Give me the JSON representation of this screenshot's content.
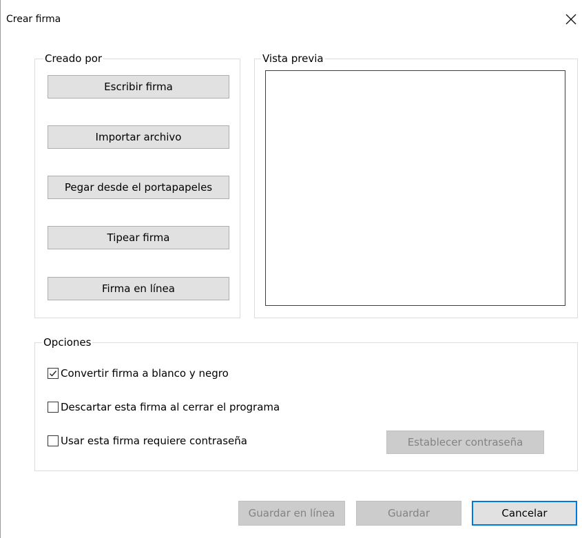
{
  "window": {
    "title": "Crear firma"
  },
  "created_by": {
    "legend": "Creado por",
    "buttons": [
      "Escribir firma",
      "Importar archivo",
      "Pegar desde el portapapeles",
      "Tipear firma",
      "Firma en línea"
    ]
  },
  "preview": {
    "legend": "Vista previa"
  },
  "options": {
    "legend": "Opciones",
    "checkboxes": [
      {
        "label": "Convertir firma a blanco y negro",
        "checked": true
      },
      {
        "label": "Descartar esta firma al cerrar el programa",
        "checked": false
      },
      {
        "label": "Usar esta firma requiere contraseña",
        "checked": false
      }
    ],
    "set_password_label": "Establecer contraseña"
  },
  "footer": {
    "save_online_label": "Guardar en línea",
    "save_label": "Guardar",
    "cancel_label": "Cancelar"
  },
  "colors": {
    "accent": "#0078d7",
    "button_bg": "#e1e1e1",
    "disabled_text": "#838383"
  },
  "icons": {
    "close": "close-icon",
    "check": "checkmark-icon"
  }
}
